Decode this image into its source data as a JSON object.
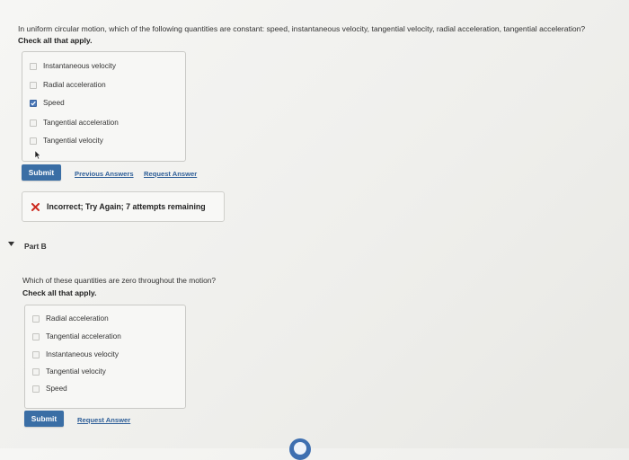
{
  "part_a": {
    "question": "In uniform circular motion, which of the following quantities are constant: speed, instantaneous velocity, tangential velocity, radial acceleration, tangential acceleration?",
    "instruction": "Check all that apply.",
    "choices": [
      {
        "label": "Instantaneous velocity",
        "checked": false
      },
      {
        "label": "Radial acceleration",
        "checked": false
      },
      {
        "label": "Speed",
        "checked": true
      },
      {
        "label": "Tangential acceleration",
        "checked": false
      },
      {
        "label": "Tangential velocity",
        "checked": false
      }
    ],
    "submit_label": "Submit",
    "previous_answers_label": "Previous Answers",
    "request_answer_label": "Request Answer",
    "feedback": "Incorrect; Try Again; 7 attempts remaining",
    "feedback_icon": "x-icon",
    "feedback_color": "#cc2a1f"
  },
  "part_b": {
    "title": "Part B",
    "question": "Which of these quantities are zero throughout the motion?",
    "instruction": "Check all that apply.",
    "choices": [
      {
        "label": "Radial acceleration",
        "checked": false
      },
      {
        "label": "Tangential acceleration",
        "checked": false
      },
      {
        "label": "Instantaneous velocity",
        "checked": false
      },
      {
        "label": "Tangential velocity",
        "checked": false
      },
      {
        "label": "Speed",
        "checked": false
      }
    ],
    "submit_label": "Submit",
    "request_answer_label": "Request Answer"
  },
  "colors": {
    "accent": "#3a6ea5",
    "link": "#2f5f98",
    "checked": "#4a78b8"
  }
}
